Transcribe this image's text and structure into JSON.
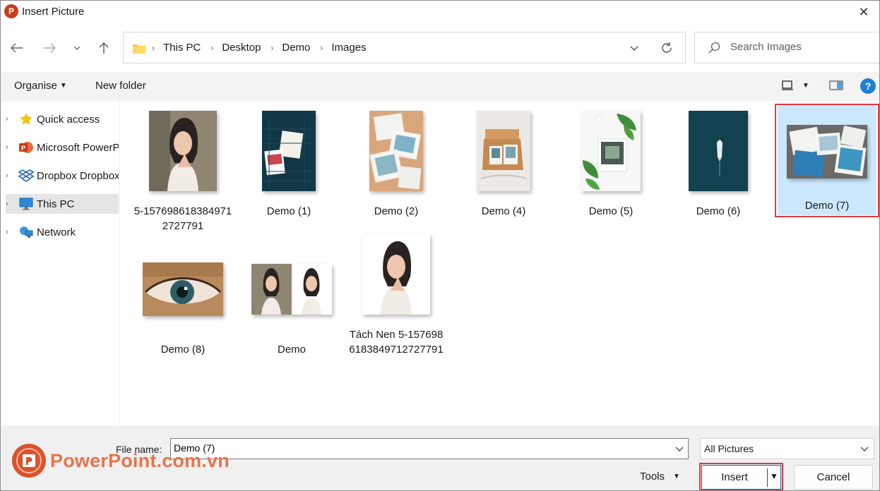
{
  "window": {
    "title": "Insert Picture",
    "app_icon_letter": "P",
    "close_glyph": "✕"
  },
  "nav": {
    "back": "←",
    "forward": "→",
    "recent": "⌄",
    "up": "↑"
  },
  "address": {
    "crumbs": [
      "This PC",
      "Desktop",
      "Demo",
      "Images"
    ],
    "separator": "›",
    "dropdown": "⌄",
    "refresh": "↻"
  },
  "search": {
    "placeholder": "Search Images"
  },
  "toolbar": {
    "organise": "Organise",
    "new_folder": "New folder",
    "help": "?"
  },
  "sidebar": {
    "items": [
      {
        "label": "Quick access",
        "icon": "star-icon"
      },
      {
        "label": "Microsoft PowerPoint",
        "icon": "powerpoint-icon"
      },
      {
        "label": "Dropbox Dropbox",
        "icon": "dropbox-icon"
      },
      {
        "label": "This PC",
        "icon": "computer-icon",
        "selected": true
      },
      {
        "label": "Network",
        "icon": "network-icon"
      }
    ]
  },
  "files": [
    {
      "name": "5-1576986183849712727791"
    },
    {
      "name": "Demo (1)"
    },
    {
      "name": "Demo (2)"
    },
    {
      "name": "Demo (4)"
    },
    {
      "name": "Demo (5)"
    },
    {
      "name": "Demo (6)"
    },
    {
      "name": "Demo (7)",
      "selected": true
    },
    {
      "name": "Demo (8)"
    },
    {
      "name": "Demo"
    },
    {
      "name": "Tách Nen 5-1576986183849712727791"
    }
  ],
  "bottom": {
    "file_name_label": "File name:",
    "file_name_value": "Demo (7)",
    "filter": "All Pictures",
    "tools": "Tools",
    "insert": "Insert",
    "cancel": "Cancel"
  },
  "watermark": {
    "text": "PowerPoint.com.vn"
  },
  "colors": {
    "accent": "#0067c0",
    "highlight": "#e1383e",
    "selection": "#cce8ff",
    "brand": "#d9532d"
  }
}
